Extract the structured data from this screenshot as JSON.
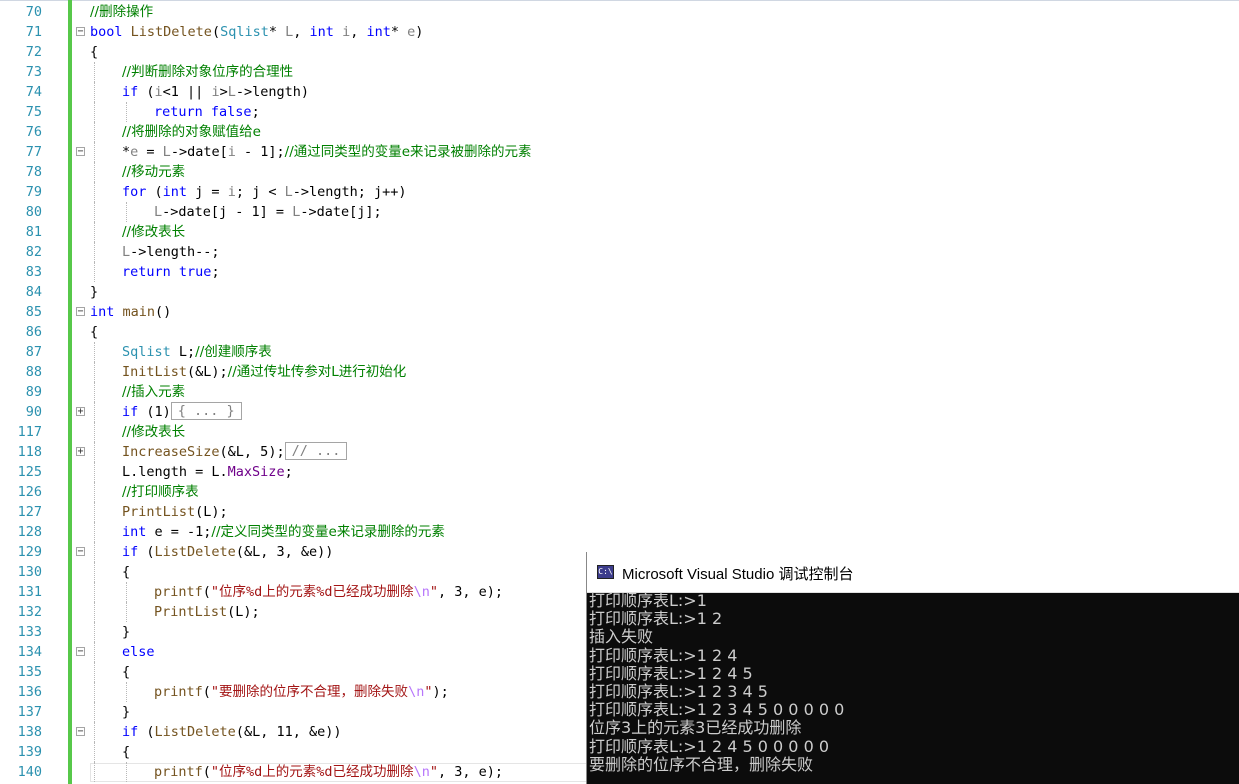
{
  "editor": {
    "lines": [
      {
        "n": "70",
        "indent": 0,
        "fold": "",
        "segs": [
          [
            "cm",
            "//删除操作"
          ]
        ]
      },
      {
        "n": "71",
        "indent": 0,
        "fold": "minus",
        "segs": [
          [
            "kw",
            "bool"
          ],
          [
            "",
            " "
          ],
          [
            "fn",
            "ListDelete"
          ],
          [
            "",
            "("
          ],
          [
            "ty",
            "Sqlist"
          ],
          [
            "",
            "* "
          ],
          [
            "pm",
            "L"
          ],
          [
            "",
            ", "
          ],
          [
            "kw",
            "int"
          ],
          [
            "",
            " "
          ],
          [
            "pm",
            "i"
          ],
          [
            "",
            ", "
          ],
          [
            "kw",
            "int"
          ],
          [
            "",
            "* "
          ],
          [
            "pm",
            "e"
          ],
          [
            "",
            ")"
          ]
        ]
      },
      {
        "n": "72",
        "indent": 0,
        "fold": "",
        "segs": [
          [
            "",
            "{"
          ]
        ]
      },
      {
        "n": "73",
        "indent": 1,
        "fold": "",
        "segs": [
          [
            "cm",
            "//判断删除对象位序的合理性"
          ]
        ]
      },
      {
        "n": "74",
        "indent": 1,
        "fold": "",
        "segs": [
          [
            "kw",
            "if"
          ],
          [
            "",
            " ("
          ],
          [
            "pm",
            "i"
          ],
          [
            "",
            "<1 || "
          ],
          [
            "pm",
            "i"
          ],
          [
            "",
            ">"
          ],
          [
            "pm",
            "L"
          ],
          [
            "",
            "->length)"
          ]
        ]
      },
      {
        "n": "75",
        "indent": 2,
        "fold": "",
        "segs": [
          [
            "kw",
            "return"
          ],
          [
            "",
            " "
          ],
          [
            "kw",
            "false"
          ],
          [
            "",
            ";"
          ]
        ]
      },
      {
        "n": "76",
        "indent": 1,
        "fold": "",
        "segs": [
          [
            "cm",
            "//将删除的对象赋值给e"
          ]
        ]
      },
      {
        "n": "77",
        "indent": 1,
        "fold": "minus",
        "segs": [
          [
            "",
            "*"
          ],
          [
            "pm",
            "e"
          ],
          [
            "",
            " = "
          ],
          [
            "pm",
            "L"
          ],
          [
            "",
            "->date["
          ],
          [
            "pm",
            "i"
          ],
          [
            "",
            " - 1];"
          ],
          [
            "cm",
            "//通过同类型的变量e来记录被删除的元素"
          ]
        ]
      },
      {
        "n": "78",
        "indent": 1,
        "fold": "",
        "segs": [
          [
            "cm",
            "//移动元素"
          ]
        ]
      },
      {
        "n": "79",
        "indent": 1,
        "fold": "",
        "segs": [
          [
            "kw",
            "for"
          ],
          [
            "",
            " ("
          ],
          [
            "kw",
            "int"
          ],
          [
            "",
            " j = "
          ],
          [
            "pm",
            "i"
          ],
          [
            "",
            "; j < "
          ],
          [
            "pm",
            "L"
          ],
          [
            "",
            "->length; j++)"
          ]
        ]
      },
      {
        "n": "80",
        "indent": 2,
        "fold": "",
        "segs": [
          [
            "pm",
            "L"
          ],
          [
            "",
            "->date[j - 1] = "
          ],
          [
            "pm",
            "L"
          ],
          [
            "",
            "->date[j];"
          ]
        ]
      },
      {
        "n": "81",
        "indent": 1,
        "fold": "",
        "segs": [
          [
            "cm",
            "//修改表长"
          ]
        ]
      },
      {
        "n": "82",
        "indent": 1,
        "fold": "",
        "segs": [
          [
            "pm",
            "L"
          ],
          [
            "",
            "->length--;"
          ]
        ]
      },
      {
        "n": "83",
        "indent": 1,
        "fold": "",
        "segs": [
          [
            "kw",
            "return"
          ],
          [
            "",
            " "
          ],
          [
            "kw",
            "true"
          ],
          [
            "",
            ";"
          ]
        ]
      },
      {
        "n": "84",
        "indent": 0,
        "fold": "",
        "segs": [
          [
            "",
            "}"
          ]
        ]
      },
      {
        "n": "85",
        "indent": 0,
        "fold": "minus",
        "segs": [
          [
            "kw",
            "int"
          ],
          [
            "",
            " "
          ],
          [
            "fn",
            "main"
          ],
          [
            "",
            "()"
          ]
        ]
      },
      {
        "n": "86",
        "indent": 0,
        "fold": "",
        "segs": [
          [
            "",
            "{"
          ]
        ]
      },
      {
        "n": "87",
        "indent": 1,
        "fold": "",
        "segs": [
          [
            "ty",
            "Sqlist"
          ],
          [
            "",
            " L;"
          ],
          [
            "cm",
            "//创建顺序表"
          ]
        ]
      },
      {
        "n": "88",
        "indent": 1,
        "fold": "",
        "segs": [
          [
            "fn",
            "InitList"
          ],
          [
            "",
            "(&L);"
          ],
          [
            "cm",
            "//通过传址传参对L进行初始化"
          ]
        ]
      },
      {
        "n": "89",
        "indent": 1,
        "fold": "",
        "segs": [
          [
            "cm",
            "//插入元素"
          ]
        ]
      },
      {
        "n": "90",
        "indent": 1,
        "fold": "plus",
        "segs": [
          [
            "kw",
            "if"
          ],
          [
            "",
            " (1)"
          ],
          [
            "box",
            "{ ... }"
          ]
        ]
      },
      {
        "n": "117",
        "indent": 1,
        "fold": "",
        "segs": [
          [
            "cm",
            "//修改表长"
          ]
        ]
      },
      {
        "n": "118",
        "indent": 1,
        "fold": "plus",
        "segs": [
          [
            "fn",
            "IncreaseSize"
          ],
          [
            "",
            "(&L, 5);"
          ],
          [
            "box",
            "// ..."
          ]
        ]
      },
      {
        "n": "125",
        "indent": 1,
        "fold": "",
        "segs": [
          [
            "",
            "L.length = L."
          ],
          [
            "mc",
            "MaxSize"
          ],
          [
            "",
            ";"
          ]
        ]
      },
      {
        "n": "126",
        "indent": 1,
        "fold": "",
        "segs": [
          [
            "cm",
            "//打印顺序表"
          ]
        ]
      },
      {
        "n": "127",
        "indent": 1,
        "fold": "",
        "segs": [
          [
            "fn",
            "PrintList"
          ],
          [
            "",
            "(L);"
          ]
        ]
      },
      {
        "n": "128",
        "indent": 1,
        "fold": "",
        "segs": [
          [
            "kw",
            "int"
          ],
          [
            "",
            " e = -1;"
          ],
          [
            "cm",
            "//定义同类型的变量e来记录删除的元素"
          ]
        ]
      },
      {
        "n": "129",
        "indent": 1,
        "fold": "minus",
        "segs": [
          [
            "kw",
            "if"
          ],
          [
            "",
            " ("
          ],
          [
            "fn",
            "ListDelete"
          ],
          [
            "",
            "(&L, 3, &e))"
          ]
        ]
      },
      {
        "n": "130",
        "indent": 1,
        "fold": "",
        "segs": [
          [
            "",
            "{"
          ]
        ]
      },
      {
        "n": "131",
        "indent": 2,
        "fold": "",
        "segs": [
          [
            "fn",
            "printf"
          ],
          [
            "",
            "("
          ],
          [
            "st",
            "\"位序%d上的元素%d已经成功删除"
          ],
          [
            "es",
            "\\n"
          ],
          [
            "st",
            "\""
          ],
          [
            "",
            ", 3, e);"
          ]
        ]
      },
      {
        "n": "132",
        "indent": 2,
        "fold": "",
        "segs": [
          [
            "fn",
            "PrintList"
          ],
          [
            "",
            "(L);"
          ]
        ]
      },
      {
        "n": "133",
        "indent": 1,
        "fold": "",
        "segs": [
          [
            "",
            "}"
          ]
        ]
      },
      {
        "n": "134",
        "indent": 1,
        "fold": "minus",
        "segs": [
          [
            "kw",
            "else"
          ]
        ]
      },
      {
        "n": "135",
        "indent": 1,
        "fold": "",
        "segs": [
          [
            "",
            "{"
          ]
        ]
      },
      {
        "n": "136",
        "indent": 2,
        "fold": "",
        "segs": [
          [
            "fn",
            "printf"
          ],
          [
            "",
            "("
          ],
          [
            "st",
            "\"要删除的位序不合理，删除失败"
          ],
          [
            "es",
            "\\n"
          ],
          [
            "st",
            "\""
          ],
          [
            "",
            ");"
          ]
        ]
      },
      {
        "n": "137",
        "indent": 1,
        "fold": "",
        "segs": [
          [
            "",
            "}"
          ]
        ]
      },
      {
        "n": "138",
        "indent": 1,
        "fold": "minus",
        "segs": [
          [
            "kw",
            "if"
          ],
          [
            "",
            " ("
          ],
          [
            "fn",
            "ListDelete"
          ],
          [
            "",
            "(&L, 11, &e))"
          ]
        ]
      },
      {
        "n": "139",
        "indent": 1,
        "fold": "",
        "segs": [
          [
            "",
            "{"
          ]
        ]
      },
      {
        "n": "140",
        "indent": 2,
        "fold": "",
        "segs": [
          [
            "fn",
            "printf"
          ],
          [
            "",
            "("
          ],
          [
            "st",
            "\"位序%d上的元素%d已经成功删除"
          ],
          [
            "es",
            "\\n"
          ],
          [
            "st",
            "\""
          ],
          [
            "",
            ", 3, e);"
          ]
        ]
      }
    ]
  },
  "console": {
    "title": "Microsoft Visual Studio 调试控制台",
    "icon": "console-app-icon",
    "lines": [
      "打印顺序表L:>1",
      "打印顺序表L:>1 2",
      "插入失败",
      "打印顺序表L:>1 2 4",
      "打印顺序表L:>1 2 4 5",
      "打印顺序表L:>1 2 3 4 5",
      "打印顺序表L:>1 2 3 4 5 0 0 0 0 0",
      "位序3上的元素3已经成功删除",
      "打印顺序表L:>1 2 4 5 0 0 0 0 0",
      "要删除的位序不合理，删除失败"
    ]
  },
  "colors": {
    "change_bar": "#57c84a",
    "line_number": "#2b91af",
    "keyword": "#0000ff",
    "comment": "#008000",
    "string": "#a31515",
    "console_bg": "#0c0c0c",
    "console_text": "#cccccc"
  }
}
